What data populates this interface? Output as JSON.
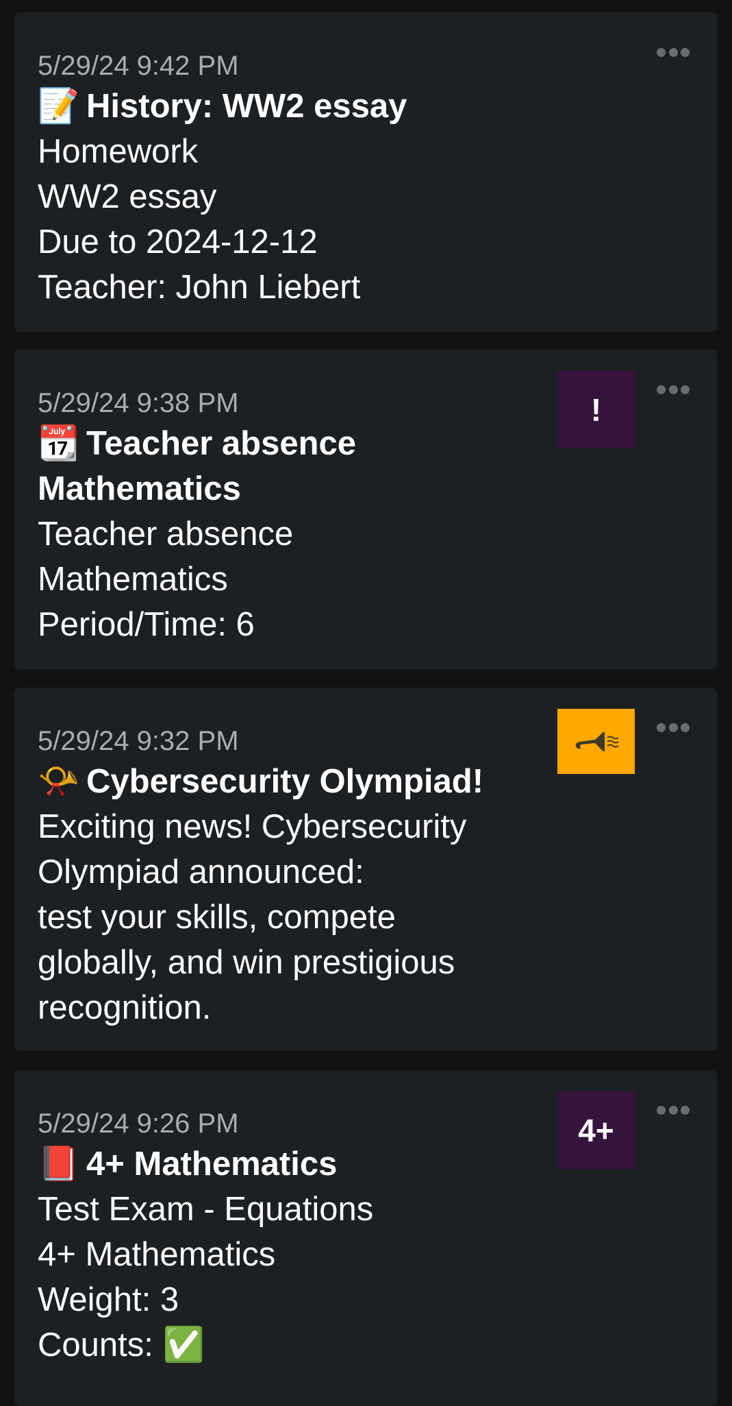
{
  "colors": {
    "badge_purple": "#36133d",
    "badge_orange": "#ffa800",
    "card_bg": "#1d2023"
  },
  "cards": [
    {
      "date": "5/29/24 9:42 PM",
      "emoji": "📝",
      "title": "History: WW2 essay",
      "lines": [
        "Homework",
        "WW2 essay",
        "Due to 2024-12-12",
        "Teacher: John Liebert"
      ]
    },
    {
      "date": "5/29/24 9:38 PM",
      "emoji": "📆",
      "title": "Teacher absence Mathematics",
      "badge": "!",
      "lines": [
        "Teacher absence",
        "Mathematics",
        "Period/Time: 6"
      ]
    },
    {
      "date": "5/29/24 9:32 PM",
      "emoji": "📯",
      "title": "Cybersecurity Olympiad!",
      "badge_icon": "horn-icon",
      "lines": [
        "Exciting news! Cybersecurity",
        "Olympiad announced:",
        "test your skills, compete",
        "globally, and win prestigious",
        "recognition."
      ]
    },
    {
      "date": "5/29/24 9:26 PM",
      "emoji": "📕",
      "title": "4+ Mathematics",
      "badge": "4+",
      "lines": [
        "Test Exam - Equations",
        "4+ Mathematics",
        "Weight: 3",
        "Counts: ✅"
      ]
    }
  ]
}
